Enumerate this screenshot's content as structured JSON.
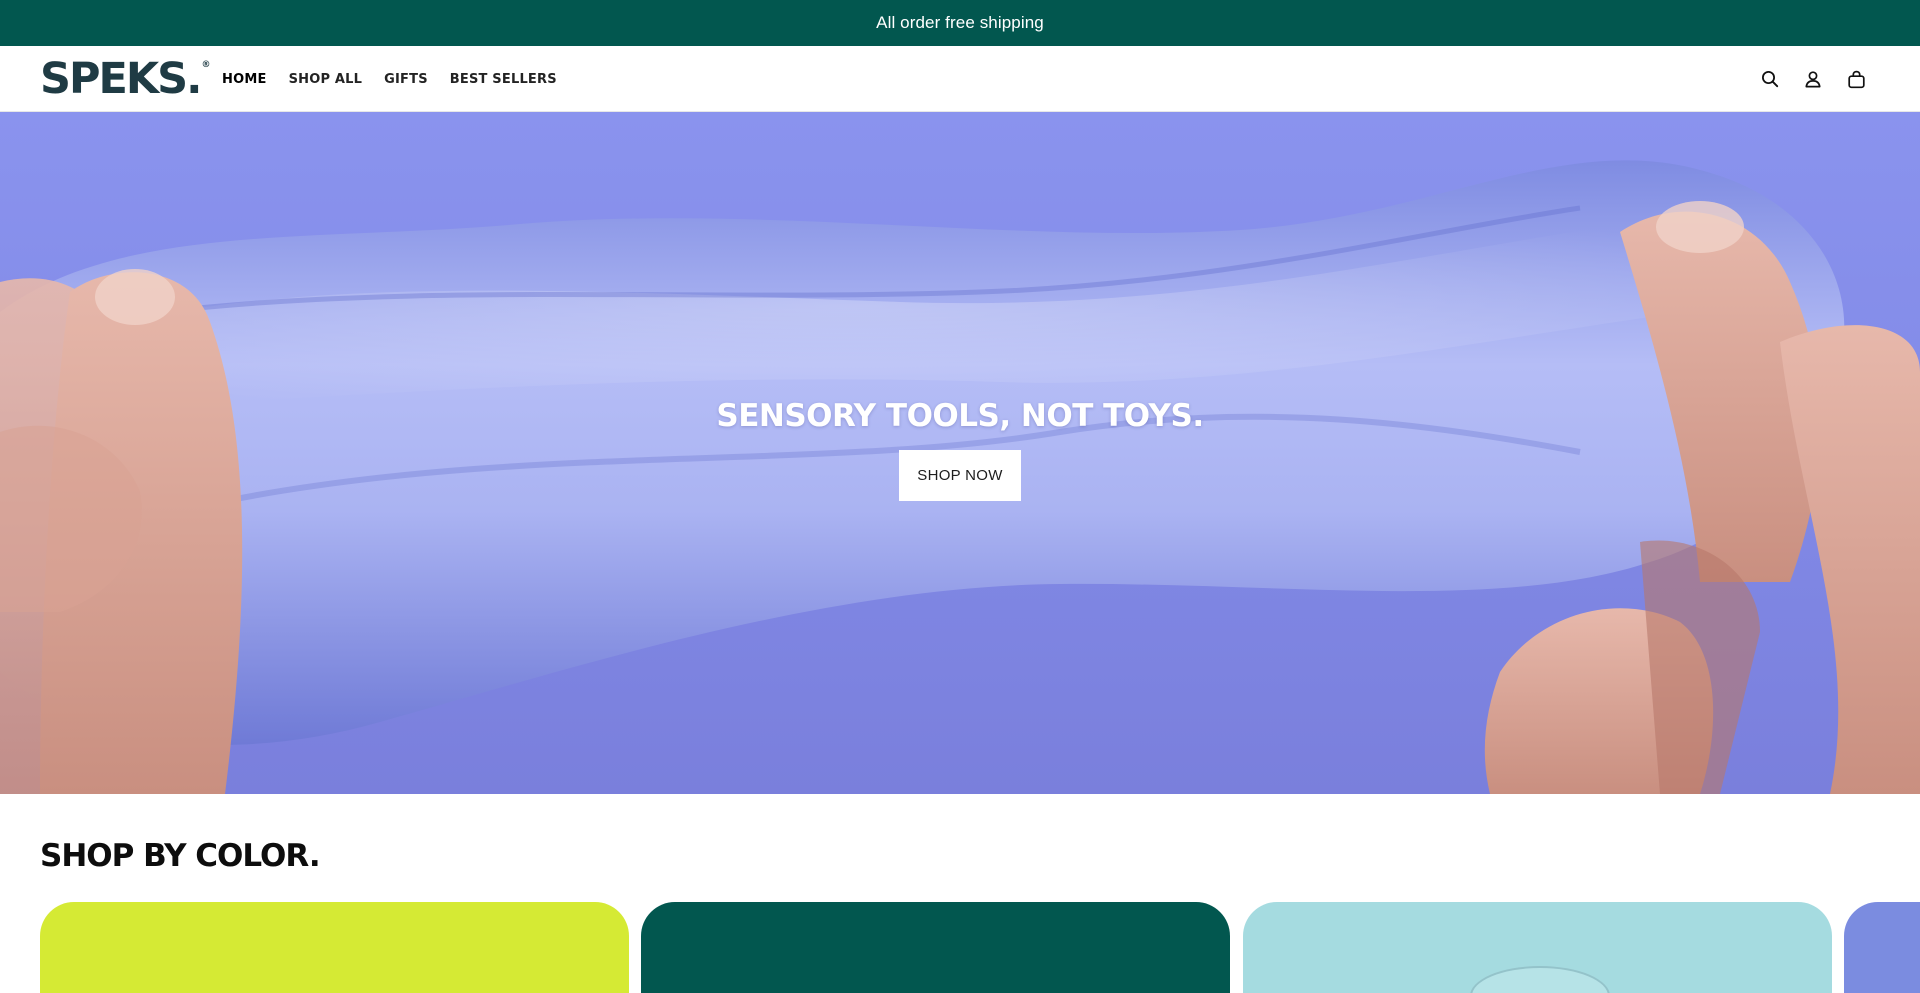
{
  "announcement": {
    "text": "All order free shipping",
    "color": "#02574f"
  },
  "header": {
    "logo_text": "SPEKS.",
    "logo_mark": "®",
    "nav": [
      {
        "label": "HOME",
        "active": true
      },
      {
        "label": "SHOP ALL"
      },
      {
        "label": "GIFTS"
      },
      {
        "label": "BEST SELLERS"
      }
    ],
    "icons": [
      "search-icon",
      "account-icon",
      "cart-icon"
    ]
  },
  "hero": {
    "title": "SENSORY TOOLS, NOT TOYS.",
    "button_label": "SHOP NOW",
    "image": "hands stretching lavender putty on periwinkle background"
  },
  "shop_by_color": {
    "title": "SHOP BY COLOR.",
    "cards": [
      {
        "color": "#d5ea34"
      },
      {
        "color": "#02574f"
      },
      {
        "color": "#a5dbe0"
      },
      {
        "color": "#7b8ce0"
      }
    ]
  }
}
